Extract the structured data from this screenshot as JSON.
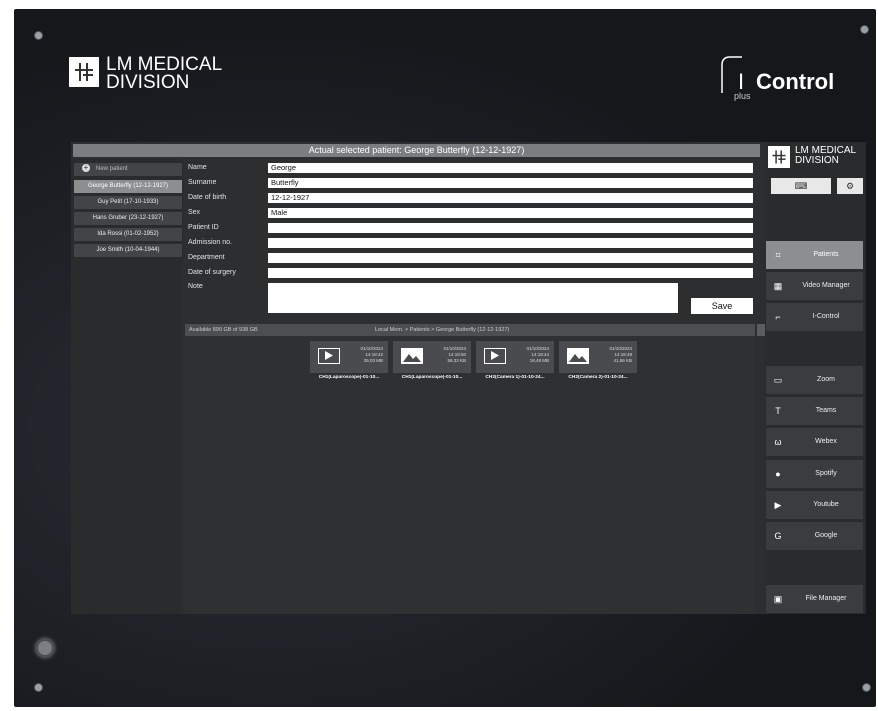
{
  "branding": {
    "company_line1": "LM MEDICAL",
    "company_line2": "DIVISION",
    "product_prefix": "I",
    "product_name": "Control",
    "product_suffix": "plus"
  },
  "header": {
    "title": "Actual selected patient: George Butterfly (12-12-1927)"
  },
  "patients": {
    "new_label": "New patient",
    "items": [
      {
        "label": "George Butterfly (12-12-1927)",
        "selected": true
      },
      {
        "label": "Guy Petit (17-10-1933)",
        "selected": false
      },
      {
        "label": "Hans Gruber (23-12-1927)",
        "selected": false
      },
      {
        "label": "Ida Rossi (01-02-1952)",
        "selected": false
      },
      {
        "label": "Joe Smith (10-04-1944)",
        "selected": false
      }
    ]
  },
  "form": {
    "fields": [
      {
        "label": "Name",
        "value": "George"
      },
      {
        "label": "Surname",
        "value": "Butterfly"
      },
      {
        "label": "Date of birth",
        "value": "12-12-1927"
      },
      {
        "label": "Sex",
        "value": "Male"
      },
      {
        "label": "Patient ID",
        "value": ""
      },
      {
        "label": "Admission no.",
        "value": ""
      },
      {
        "label": "Department",
        "value": ""
      },
      {
        "label": "Date of surgery",
        "value": ""
      }
    ],
    "note_label": "Note",
    "note_value": "",
    "save_label": "Save"
  },
  "storage": {
    "available": "Available 890 GB of 938 GB",
    "path": "Local Mem. > Patients > George Butterfly (12-12-1927)"
  },
  "files": [
    {
      "type": "video",
      "date": "01/10/2024",
      "time": "14:18:42",
      "size": "35,03 MB",
      "name": "CH1(Laparoscope)-01-10..."
    },
    {
      "type": "image",
      "date": "01/10/2024",
      "time": "14:18:50",
      "size": "59,33 KB",
      "name": "CH1(Laparoscope)-01-10..."
    },
    {
      "type": "video",
      "date": "01/10/2024",
      "time": "14:18:44",
      "size": "18,48 MB",
      "name": "CH2(Camera 1)-01-10-24..."
    },
    {
      "type": "image",
      "date": "01/10/2024",
      "time": "14:18:48",
      "size": "41,56 KB",
      "name": "CH2(Camera 2)-01-10-24..."
    }
  ],
  "side_menu": {
    "items": [
      {
        "label": "Patients",
        "icon": "patients-icon",
        "active": true
      },
      {
        "label": "Video Manager",
        "icon": "grid-icon",
        "active": false
      },
      {
        "label": "I-Control",
        "icon": "icontrol-icon",
        "active": false
      },
      {
        "label": "Zoom",
        "icon": "camera-icon",
        "active": false
      },
      {
        "label": "Teams",
        "icon": "teams-icon",
        "active": false
      },
      {
        "label": "Webex",
        "icon": "webex-icon",
        "active": false
      },
      {
        "label": "Spotify",
        "icon": "spotify-icon",
        "active": false
      },
      {
        "label": "Youtube",
        "icon": "youtube-icon",
        "active": false
      },
      {
        "label": "Google",
        "icon": "google-icon",
        "active": false
      },
      {
        "label": "File Manager",
        "icon": "file-manager-icon",
        "active": false
      }
    ]
  }
}
